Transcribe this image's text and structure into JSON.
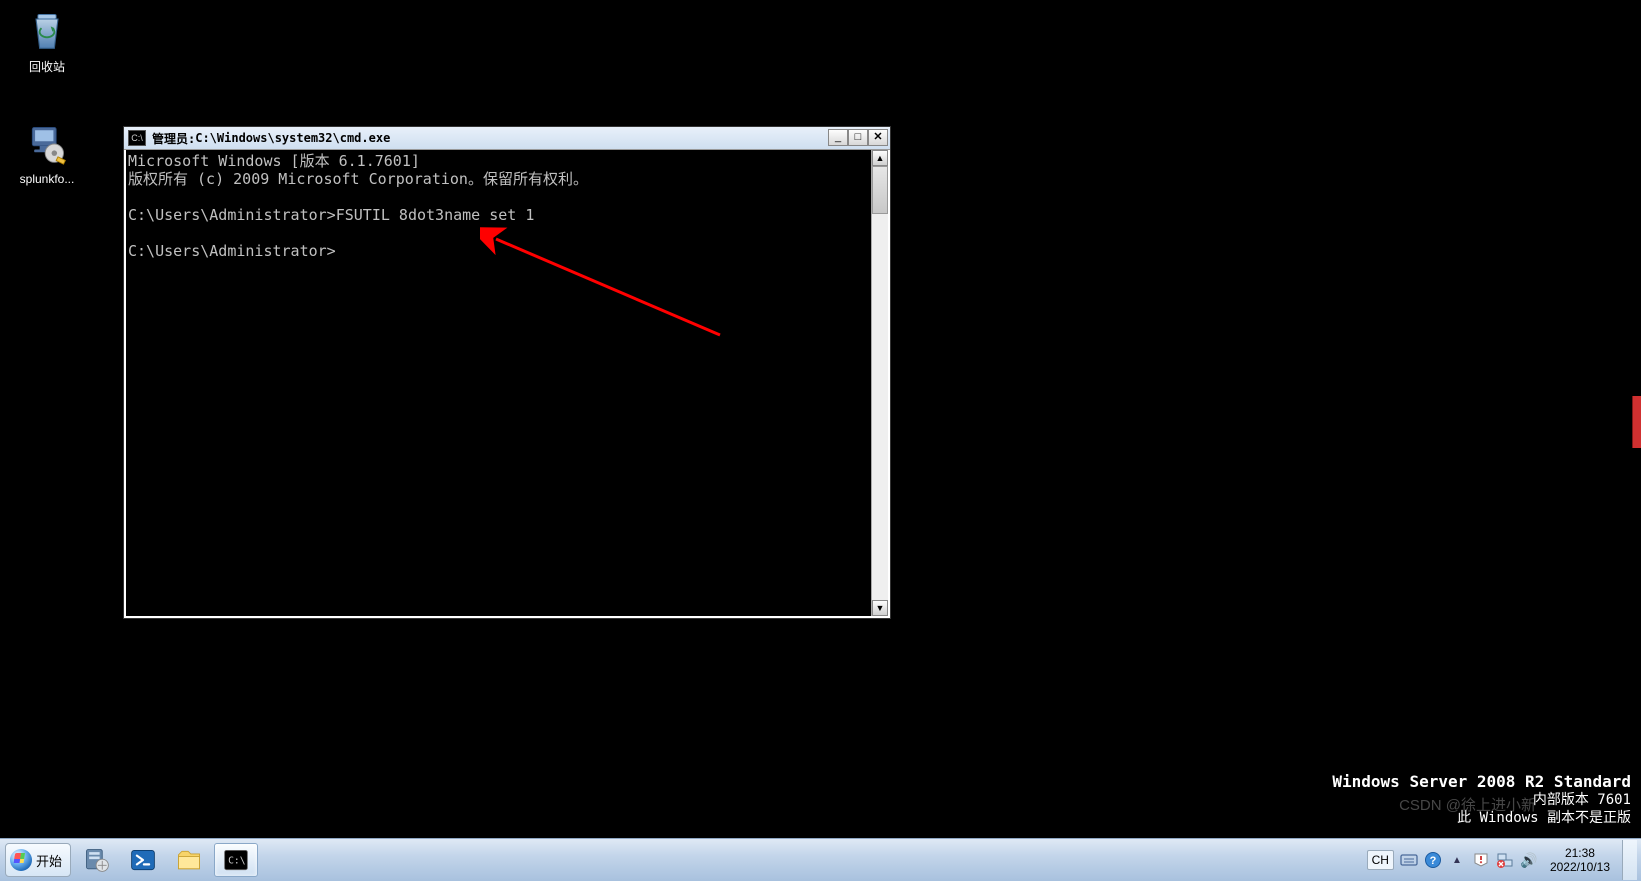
{
  "desktop": {
    "recycle_bin_label": "回收站",
    "splunk_label": "splunkfo..."
  },
  "cmd": {
    "title_prefix": "管理员: ",
    "title_path": "C:\\Windows\\system32\\cmd.exe",
    "lines": [
      "Microsoft Windows [版本 6.1.7601]",
      "版权所有 (c) 2009 Microsoft Corporation。保留所有权利。",
      "",
      "C:\\Users\\Administrator>FSUTIL 8dot3name set 1",
      "",
      "C:\\Users\\Administrator>"
    ],
    "btn_min_glyph": "_",
    "btn_max_glyph": "□",
    "btn_close_glyph": "✕"
  },
  "os_info": {
    "line1": "Windows Server 2008 R2 Standard",
    "line2": "内部版本 7601",
    "line3": "此 Windows 副本不是正版"
  },
  "watermark": "CSDN @徐上进小新",
  "taskbar": {
    "start_label": "开始"
  },
  "tray": {
    "lang": "CH",
    "time": "21:38",
    "date": "2022/10/13",
    "tray_chevron_glyph": "▲",
    "tray_flag_glyph": "⚐",
    "tray_help_glyph": "?",
    "tray_sound_glyph": "🔊",
    "tray_warn_glyph": "⓪"
  }
}
